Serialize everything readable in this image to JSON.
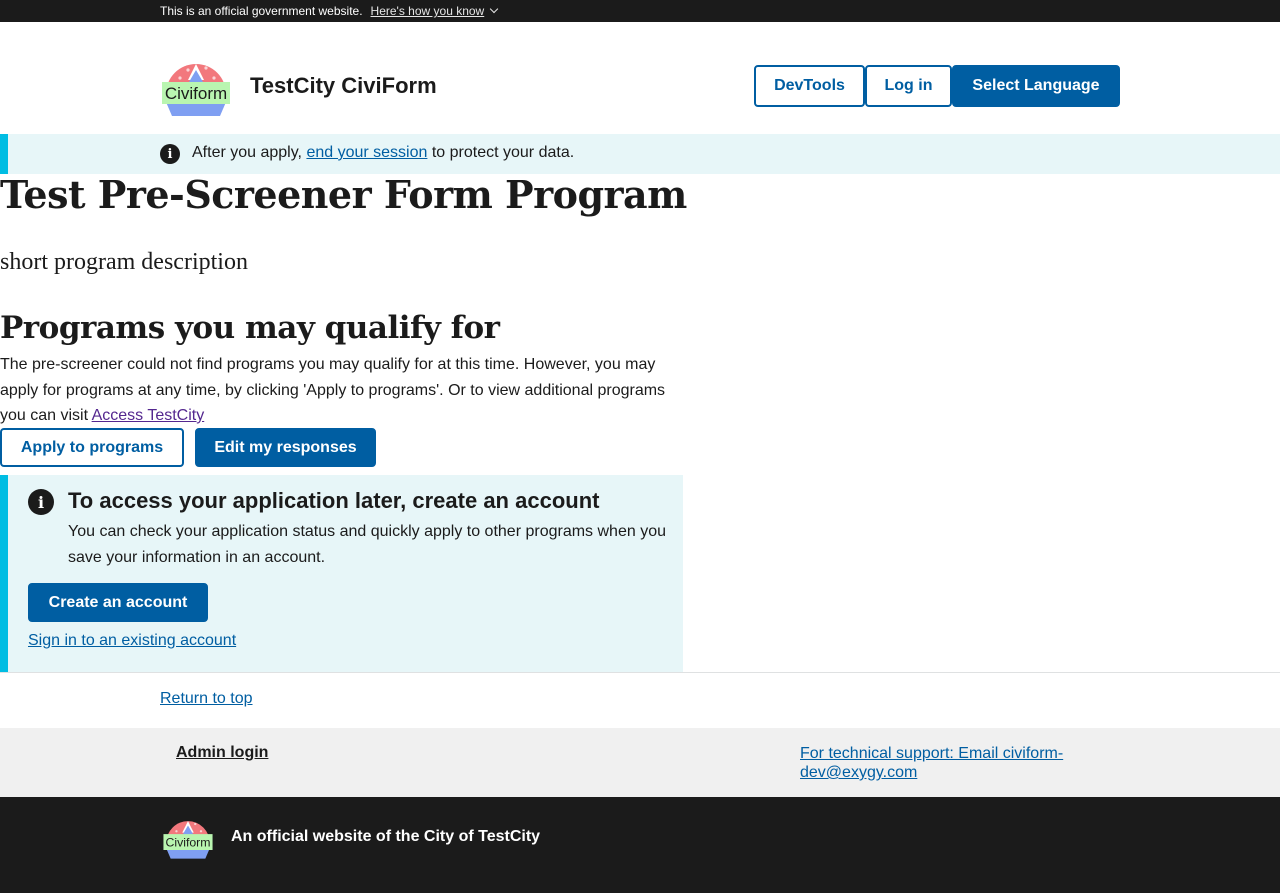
{
  "gov_banner": {
    "text": "This is an official government website.",
    "link": "Here's how you know"
  },
  "header": {
    "logo_text": "Civiform",
    "site_title": "TestCity CiviForm",
    "devtools": "DevTools",
    "login": "Log in",
    "language": "Select Language"
  },
  "session_alert": {
    "before": "After you apply, ",
    "link": "end your session",
    "after": " to protect your data."
  },
  "program": {
    "title": "Test Pre-Screener Form Program",
    "description": "short program description"
  },
  "qualify": {
    "heading": "Programs you may qualify for",
    "text": "The pre-screener could not find programs you may qualify for at this time. However, you may apply for programs at any time, by clicking 'Apply to programs'. Or to view additional programs you can visit ",
    "link": "Access TestCity",
    "apply_button": "Apply to programs",
    "edit_button": "Edit my responses"
  },
  "account_alert": {
    "heading": "To access your application later, create an account",
    "text": "You can check your application status and quickly apply to other programs when you save your information in an account.",
    "create_button": "Create an account",
    "signin_link": "Sign in to an existing account"
  },
  "return_to_top": "Return to top",
  "footer": {
    "admin_login": "Admin login",
    "support": "For technical support: Email civiform-dev@exygy.com",
    "logo_text": "Civiform",
    "official": "An official website of the City of TestCity"
  }
}
